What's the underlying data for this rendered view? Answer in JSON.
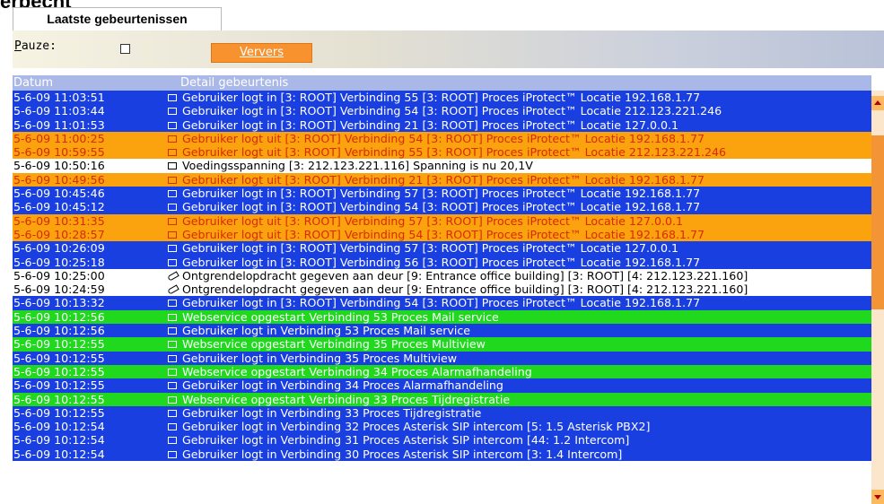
{
  "cut_title": "erbecht",
  "tab": {
    "label": "Laatste gebeurtenissen"
  },
  "toolbar": {
    "pause_label": "auze:",
    "pause_accel": "P",
    "refresh_label": "Ververs"
  },
  "colors": {
    "login": "#1a3fe0",
    "logout": "#fba20f",
    "service": "#20d91f",
    "white": "#ffffff",
    "header": "#a9b8e6"
  },
  "table": {
    "columns": [
      "Datum",
      "Detail gebeurtenis"
    ],
    "rows": [
      {
        "date": "5-6-09 11:03:51",
        "text": "Gebruiker logt in [3: ROOT] Verbinding 55 [3: ROOT] Proces iProtect™ Locatie 192.168.1.77",
        "type": "login",
        "icon": "document-icon"
      },
      {
        "date": "5-6-09 11:03:44",
        "text": "Gebruiker logt in [3: ROOT] Verbinding 54 [3: ROOT] Proces iProtect™ Locatie 212.123.221.246",
        "type": "login",
        "icon": "document-icon"
      },
      {
        "date": "5-6-09 11:01:53",
        "text": "Gebruiker logt in [3: ROOT] Verbinding 21 [3: ROOT] Proces iProtect™ Locatie 127.0.0.1",
        "type": "login",
        "icon": "document-icon"
      },
      {
        "date": "5-6-09 11:00:25",
        "text": "Gebruiker logt uit [3: ROOT] Verbinding 54 [3: ROOT] Proces iProtect™ Locatie 192.168.1.77",
        "type": "logout",
        "icon": "document-icon"
      },
      {
        "date": "5-6-09 10:59:55",
        "text": "Gebruiker logt uit [3: ROOT] Verbinding 55 [3: ROOT] Proces iProtect™ Locatie 212.123.221.246",
        "type": "logout",
        "icon": "document-icon"
      },
      {
        "date": "5-6-09 10:50:16",
        "text": "Voedingsspanning [3: 212.123.221.116] Spanning is nu 20,1V",
        "type": "white",
        "icon": "document-icon"
      },
      {
        "date": "5-6-09 10:49:56",
        "text": "Gebruiker logt uit [3: ROOT] Verbinding 21 [3: ROOT] Proces iProtect™ Locatie 192.168.1.77",
        "type": "logout",
        "icon": "document-icon"
      },
      {
        "date": "5-6-09 10:45:46",
        "text": "Gebruiker logt in [3: ROOT] Verbinding 57 [3: ROOT] Proces iProtect™ Locatie 192.168.1.77",
        "type": "login",
        "icon": "document-icon"
      },
      {
        "date": "5-6-09 10:45:12",
        "text": "Gebruiker logt in [3: ROOT] Verbinding 54 [3: ROOT] Proces iProtect™ Locatie 192.168.1.77",
        "type": "login",
        "icon": "document-icon"
      },
      {
        "date": "5-6-09 10:31:35",
        "text": "Gebruiker logt uit [3: ROOT] Verbinding 57 [3: ROOT] Proces iProtect™ Locatie 127.0.0.1",
        "type": "logout",
        "icon": "document-icon"
      },
      {
        "date": "5-6-09 10:28:57",
        "text": "Gebruiker logt uit [3: ROOT] Verbinding 54 [3: ROOT] Proces iProtect™ Locatie 192.168.1.77",
        "type": "logout",
        "icon": "document-icon"
      },
      {
        "date": "5-6-09 10:26:09",
        "text": "Gebruiker logt in [3: ROOT] Verbinding 57 [3: ROOT] Proces iProtect™ Locatie 127.0.0.1",
        "type": "login",
        "icon": "document-icon"
      },
      {
        "date": "5-6-09 10:25:18",
        "text": "Gebruiker logt in [3: ROOT] Verbinding 56 [3: ROOT] Proces iProtect™ Locatie 192.168.1.77",
        "type": "login",
        "icon": "document-icon"
      },
      {
        "date": "5-6-09 10:25:00",
        "text": "Ontgrendelopdracht gegeven aan deur [9: Entrance office building] [3: ROOT] [4: 212.123.221.160]",
        "type": "white",
        "icon": "key-icon"
      },
      {
        "date": "5-6-09 10:24:59",
        "text": "Ontgrendelopdracht gegeven aan deur [9: Entrance office building] [3: ROOT] [4: 212.123.221.160]",
        "type": "white",
        "icon": "key-icon"
      },
      {
        "date": "5-6-09 10:13:32",
        "text": "Gebruiker logt in [3: ROOT] Verbinding 54 [3: ROOT] Proces iProtect™ Locatie 192.168.1.77",
        "type": "login",
        "icon": "document-icon"
      },
      {
        "date": "5-6-09 10:12:56",
        "text": "Webservice opgestart Verbinding 53 Proces Mail service",
        "type": "green",
        "icon": "document-icon"
      },
      {
        "date": "5-6-09 10:12:56",
        "text": "Gebruiker logt in Verbinding 53 Proces Mail service",
        "type": "login",
        "icon": "document-icon"
      },
      {
        "date": "5-6-09 10:12:55",
        "text": "Webservice opgestart Verbinding 35 Proces Multiview",
        "type": "green",
        "icon": "document-icon"
      },
      {
        "date": "5-6-09 10:12:55",
        "text": "Gebruiker logt in Verbinding 35 Proces Multiview",
        "type": "login",
        "icon": "document-icon"
      },
      {
        "date": "5-6-09 10:12:55",
        "text": "Webservice opgestart Verbinding 34 Proces Alarmafhandeling",
        "type": "green",
        "icon": "document-icon"
      },
      {
        "date": "5-6-09 10:12:55",
        "text": "Gebruiker logt in Verbinding 34 Proces Alarmafhandeling",
        "type": "login",
        "icon": "document-icon"
      },
      {
        "date": "5-6-09 10:12:55",
        "text": "Webservice opgestart Verbinding 33 Proces Tijdregistratie",
        "type": "green",
        "icon": "document-icon"
      },
      {
        "date": "5-6-09 10:12:55",
        "text": "Gebruiker logt in Verbinding 33 Proces Tijdregistratie",
        "type": "login",
        "icon": "document-icon"
      },
      {
        "date": "5-6-09 10:12:54",
        "text": "Gebruiker logt in Verbinding 32 Proces Asterisk SIP intercom [5: 1.5 Asterisk PBX2]",
        "type": "login",
        "icon": "document-icon"
      },
      {
        "date": "5-6-09 10:12:54",
        "text": "Gebruiker logt in Verbinding 31 Proces Asterisk SIP intercom [44: 1.2 Intercom]",
        "type": "login",
        "icon": "document-icon"
      },
      {
        "date": "5-6-09 10:12:54",
        "text": "Gebruiker logt in Verbinding 30 Proces Asterisk SIP intercom [3: 1.4 Intercom]",
        "type": "login",
        "icon": "document-icon"
      }
    ]
  }
}
